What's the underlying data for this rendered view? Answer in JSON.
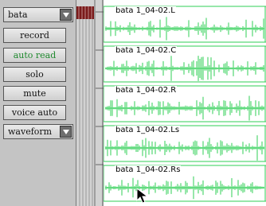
{
  "track_panel": {
    "track_name": "bata",
    "buttons": {
      "record": "record",
      "automation": "auto read",
      "solo": "solo",
      "mute": "mute",
      "voice": "voice auto"
    },
    "view_mode": "waveform"
  },
  "lanes": [
    {
      "label": "bata 1_04-02.L"
    },
    {
      "label": "bata 1_04-02.C"
    },
    {
      "label": "bata 1_04-02.R"
    },
    {
      "label": "bata 1_04-02.Ls"
    },
    {
      "label": "bata 1_04-02.Rs"
    }
  ],
  "colors": {
    "waveform": "#2fcf55",
    "meter": "#7a1a1a",
    "automation_text": "#1f8a2e"
  }
}
